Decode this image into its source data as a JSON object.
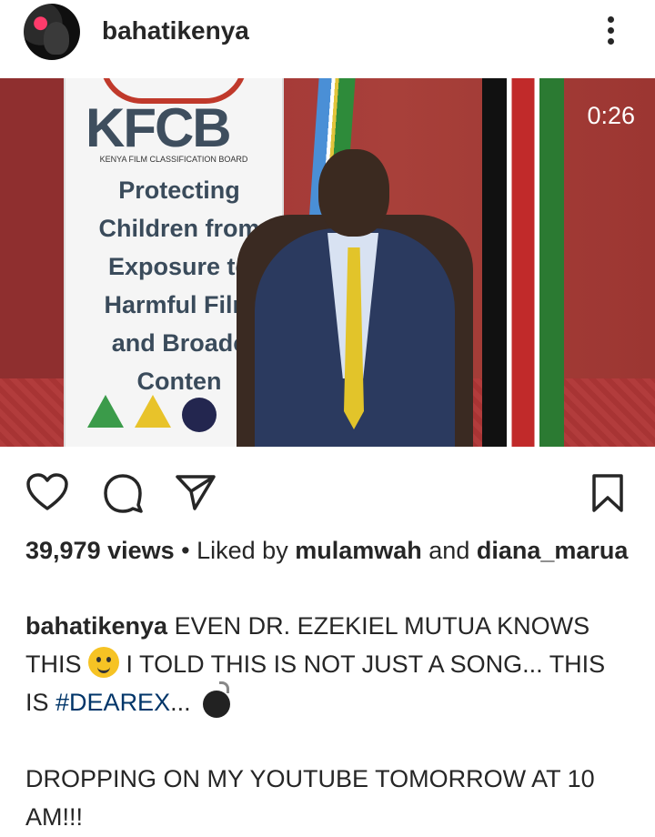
{
  "header": {
    "username": "bahatikenya"
  },
  "media": {
    "timer": "0:26",
    "banner_logo": "KFCB",
    "banner_sub": "KENYA FILM CLASSIFICATION BOARD",
    "banner_text": "Protecting Children from Exposure to Harmful Film and Broadc Conten"
  },
  "stats": {
    "views": "39,979 views",
    "separator": "•",
    "liked_by_prefix": "Liked by",
    "liked_user_1": "mulamwah",
    "and": "and",
    "liked_user_2": "diana_marua"
  },
  "caption": {
    "username": "bahatikenya",
    "text_1": "EVEN DR. EZEKIEL MUTUA KNOWS THIS",
    "text_2": "I TOLD THIS IS NOT JUST A SONG... THIS IS",
    "hashtag": "#DEAREX",
    "text_3": "...",
    "text_4": "DROPPING ON MY YOUTUBE TOMORROW AT 10 AM!!!"
  },
  "icons": {
    "more": "more-vertical-icon",
    "like": "heart-icon",
    "comment": "comment-icon",
    "share": "send-icon",
    "save": "bookmark-icon"
  }
}
